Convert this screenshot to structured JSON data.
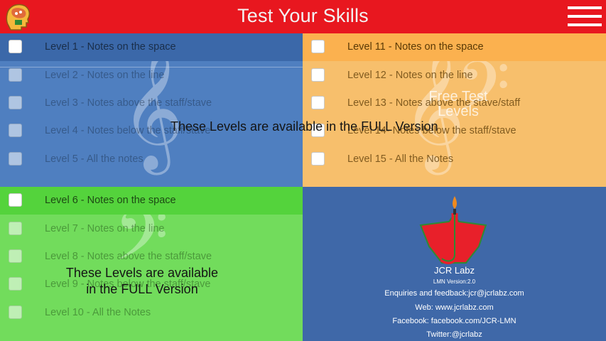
{
  "header": {
    "title": "Test Your Skills",
    "logo_icon": "head-brain-music-icon",
    "menu_icon": "hamburger-menu-icon",
    "color": "#e8171f"
  },
  "quadrants": {
    "blue": {
      "color": "#4f7fc0",
      "levels": [
        "Level 1 - Notes on the space",
        "Level 2 - Notes on the line",
        "Level 3 - Notes above the staff/stave",
        "Level 4 - Notes below the staff/stave",
        "Level 5 - All the notes"
      ]
    },
    "orange": {
      "color": "#f7bf6c",
      "levels": [
        "Level 11 - Notes on the space",
        "Level 12 - Notes on the line",
        "Level 13 - Notes above the stave/staff",
        "Level 14- Notes below the staff/stave",
        "Level 15 - All the Notes"
      ],
      "watermark": "Free Test\nLevels"
    },
    "green": {
      "color": "#72dc5c",
      "levels": [
        "Level 6 - Notes on the space",
        "Level 7 - Notes on the line",
        "Level 8 - Notes above the staff/stave",
        "Level 9 - Notes below the staff/stave",
        "Level 10 - All the Notes"
      ]
    }
  },
  "overlays": {
    "top": "These Levels are available in the FULL Version",
    "green": "These Levels are available\nin the FULL Version"
  },
  "info": {
    "company": "JCR Labz",
    "version": "LMN Version:2.0",
    "enquiries": "Enquiries and feedback:jcr@jcrlabz.com",
    "web": "Web: www.jcrlabz.com",
    "facebook": "Facebook: facebook.com/JCR-LMN",
    "twitter": "Twitter:@jcrlabz",
    "logo_icon": "jcr-labz-logo-icon"
  }
}
